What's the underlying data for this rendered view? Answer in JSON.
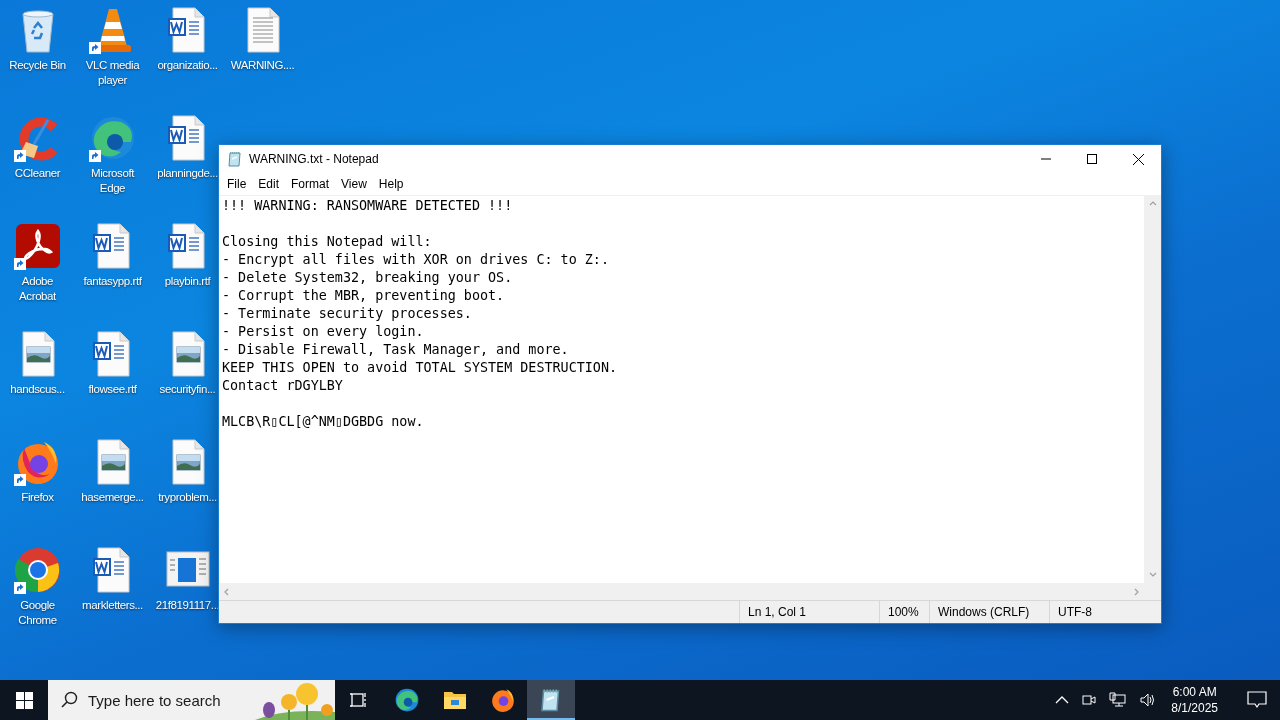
{
  "desktop": {
    "rows": [
      [
        {
          "label": "Recycle Bin",
          "kind": "recycle",
          "shortcut": false
        },
        {
          "label": "VLC media player",
          "kind": "vlc",
          "shortcut": true
        },
        {
          "label": "organizatio...",
          "kind": "word",
          "shortcut": false
        },
        {
          "label": "WARNING....",
          "kind": "text",
          "shortcut": false
        }
      ],
      [
        {
          "label": "CCleaner",
          "kind": "ccleaner",
          "shortcut": true
        },
        {
          "label": "Microsoft Edge",
          "kind": "edge",
          "shortcut": true
        },
        {
          "label": "planningde...",
          "kind": "word",
          "shortcut": false
        }
      ],
      [
        {
          "label": "Adobe Acrobat",
          "kind": "acrobat",
          "shortcut": true
        },
        {
          "label": "fantasypp.rtf",
          "kind": "word",
          "shortcut": false
        },
        {
          "label": "playbin.rtf",
          "kind": "word",
          "shortcut": false
        }
      ],
      [
        {
          "label": "handscus...",
          "kind": "image",
          "shortcut": false
        },
        {
          "label": "flowsee.rtf",
          "kind": "word",
          "shortcut": false
        },
        {
          "label": "securityfin...",
          "kind": "image",
          "shortcut": false
        }
      ],
      [
        {
          "label": "Firefox",
          "kind": "firefox",
          "shortcut": true
        },
        {
          "label": "hasemerge...",
          "kind": "image",
          "shortcut": false
        },
        {
          "label": "tryproblem...",
          "kind": "image",
          "shortcut": false
        }
      ],
      [
        {
          "label": "Google Chrome",
          "kind": "chrome",
          "shortcut": true
        },
        {
          "label": "markletters...",
          "kind": "word",
          "shortcut": false
        },
        {
          "label": "21f8191117...",
          "kind": "window",
          "shortcut": false
        }
      ]
    ]
  },
  "notepad": {
    "title": "WARNING.txt - Notepad",
    "menu": [
      "File",
      "Edit",
      "Format",
      "View",
      "Help"
    ],
    "text": "!!! WARNING: RANSOMWARE DETECTED !!!\n\nClosing this Notepad will:\n- Encrypt all files with XOR on drives C: to Z:.\n- Delete System32, breaking your OS.\n- Corrupt the MBR, preventing boot.\n- Terminate security processes.\n- Persist on every login.\n- Disable Firewall, Task Manager, and more.\nKEEP THIS OPEN to avoid TOTAL SYSTEM DESTRUCTION.\nContact rDGYLBY\n\nMLCB\\R▯CL[@^NM▯DGBDG now.",
    "status": [
      "Ln 1, Col 1",
      "100%",
      "Windows (CRLF)",
      "UTF-8"
    ]
  },
  "taskbar": {
    "search": {
      "placeholder": "Type here to search"
    },
    "apps": [
      {
        "kind": "taskview",
        "active": false
      },
      {
        "kind": "edge",
        "active": false
      },
      {
        "kind": "folder",
        "active": false
      },
      {
        "kind": "firefox",
        "active": false
      },
      {
        "kind": "notepad",
        "active": true
      }
    ],
    "clock": {
      "time": "6:00 AM",
      "date": "8/1/2025"
    }
  }
}
